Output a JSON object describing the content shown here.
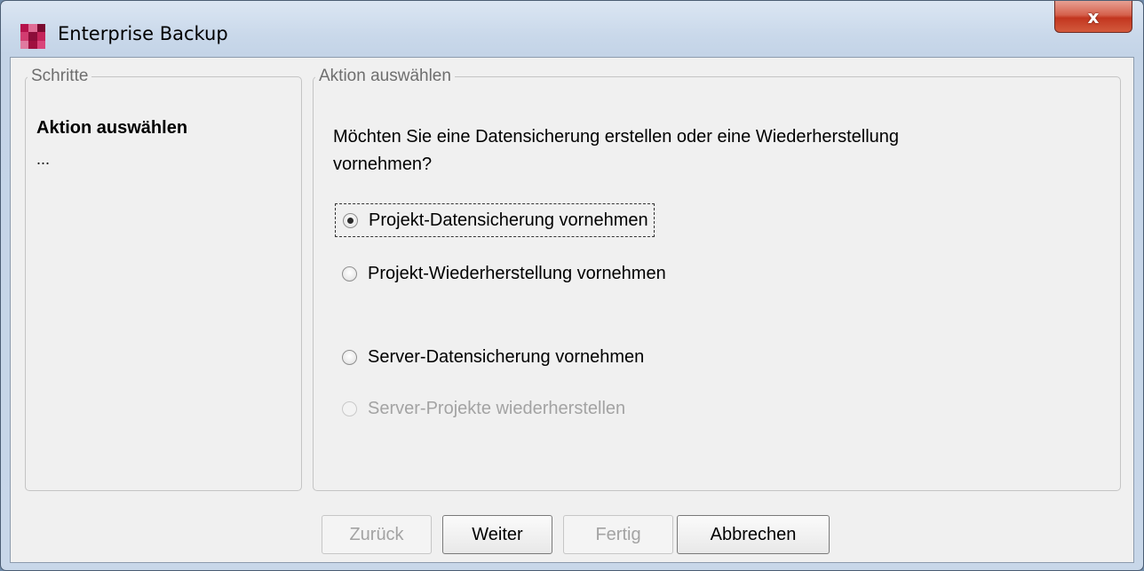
{
  "window": {
    "title": "Enterprise Backup",
    "close_label": "x"
  },
  "steps_panel": {
    "legend": "Schritte",
    "current_step": "Aktion auswählen",
    "more": "..."
  },
  "action_panel": {
    "legend": "Aktion auswählen",
    "question": "Möchten Sie eine Datensicherung erstellen oder eine Wiederherstellung vornehmen?",
    "options": [
      {
        "label": "Projekt-Datensicherung vornehmen",
        "selected": true,
        "enabled": true
      },
      {
        "label": "Projekt-Wiederherstellung vornehmen",
        "selected": false,
        "enabled": true
      },
      {
        "label": "Server-Datensicherung vornehmen",
        "selected": false,
        "enabled": true
      },
      {
        "label": "Server-Projekte wiederherstellen",
        "selected": false,
        "enabled": false
      }
    ]
  },
  "buttons": {
    "back": "Zurück",
    "next": "Weiter",
    "finish": "Fertig",
    "cancel": "Abbrechen"
  },
  "colors": {
    "titlebar": "#c8d7e9",
    "close_button": "#c2361f",
    "disabled_text": "#a3a3a3"
  }
}
